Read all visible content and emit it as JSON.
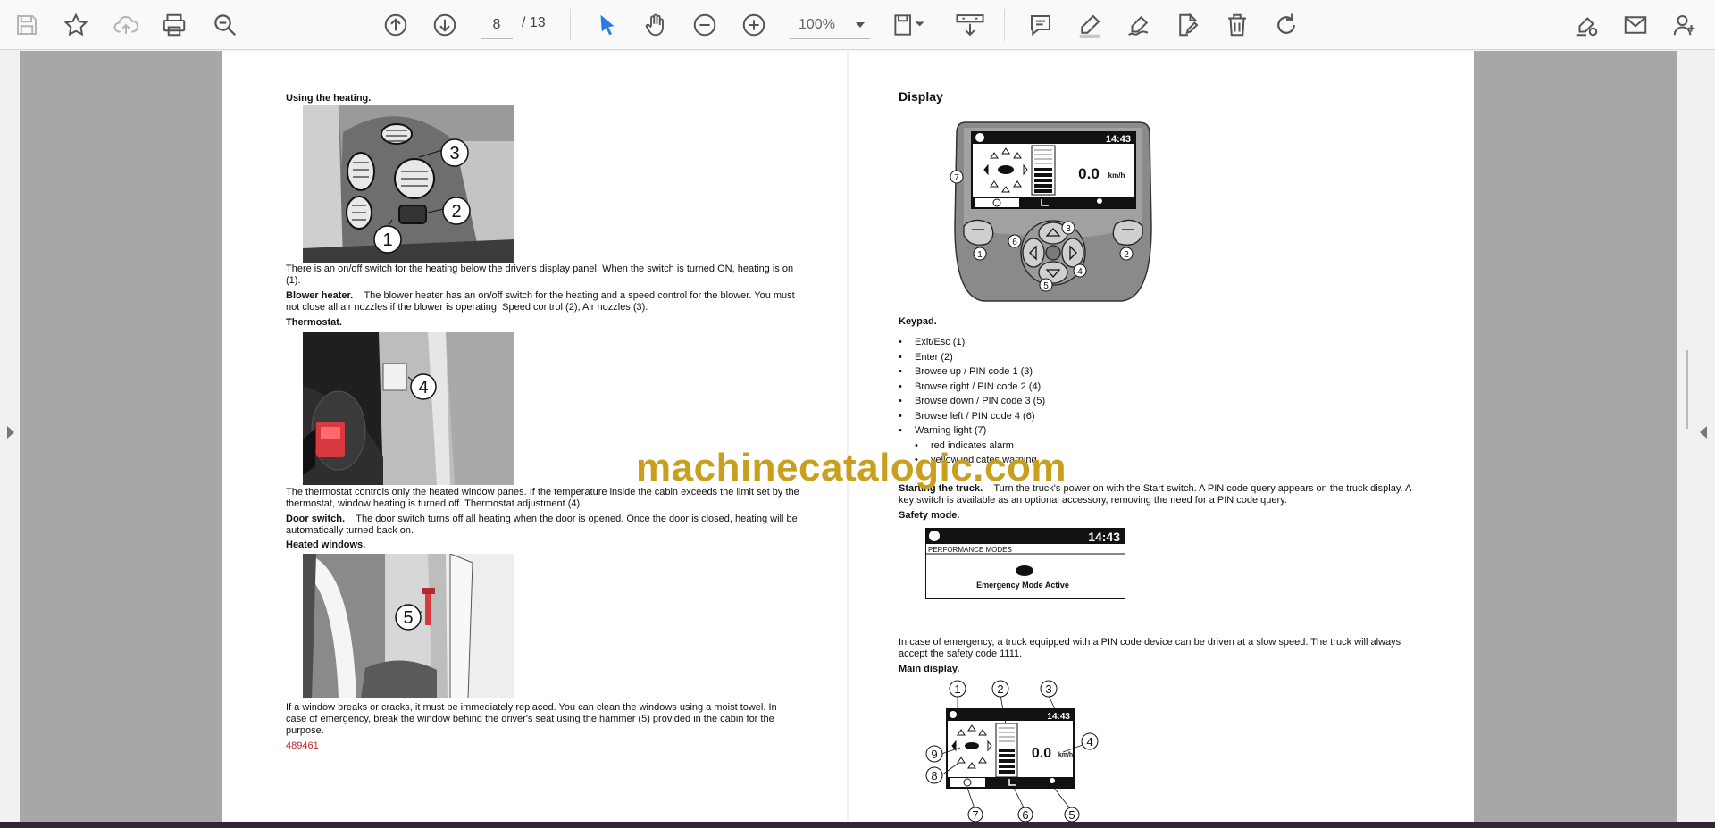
{
  "toolbar": {
    "current_page": "8",
    "total_pages": "/ 13",
    "zoom": "100%"
  },
  "left_page": {
    "heating_heading": "Using the heating.",
    "heating_text": "There is an on/off switch for the heating below the driver's display panel. When the switch is turned ON, heating is on (1).",
    "blower_label": "Blower heater.",
    "blower_text": "The blower heater has an on/off switch for the heating and a speed control for the blower. You must not close all air nozzles if the blower is operating. Speed control (2), Air nozzles (3).",
    "thermostat_heading": "Thermostat.",
    "thermostat_text": "The thermostat controls only the heated window panes. If the temperature inside the cabin exceeds the limit set by the thermostat, window heating is turned off. Thermostat adjustment (4).",
    "door_label": "Door switch.",
    "door_text": "The door switch turns off all heating when the door is opened. Once the door is closed, heating will be automatically turned back on.",
    "windows_heading": "Heated windows.",
    "windows_text": "If a window breaks or cracks, it must be immediately replaced. You can clean the windows using a moist towel. In case of emergency, break the window behind the driver's seat using the hammer (5) provided in the cabin for the purpose.",
    "doc_number": "489461",
    "fig1_callouts": [
      "3",
      "2",
      "1"
    ],
    "fig2_callout": "4",
    "fig3_callout": "5"
  },
  "right_page": {
    "display_heading": "Display",
    "display_time": "14:43",
    "display_speed": "0.0",
    "display_unit": "km/h",
    "keypad_callouts": [
      "7",
      "3",
      "6",
      "1",
      "2",
      "4",
      "5"
    ],
    "keypad_heading": "Keypad.",
    "keypad_items": [
      "Exit/Esc (1)",
      "Enter (2)",
      "Browse up / PIN code 1 (3)",
      "Browse right / PIN code 2 (4)",
      "Browse down / PIN code 3 (5)",
      "Browse left / PIN code 4 (6)",
      "Warning light (7)"
    ],
    "warning_sub_items": [
      "red indicates alarm",
      "yellow indicates warning"
    ],
    "starting_label": "Starting the truck.",
    "starting_text": "Turn the truck's power on with the Start switch. A PIN code query appears on the truck display. A key switch is available as an optional accessory, removing the need for a PIN code query.",
    "safety_heading": "Safety mode.",
    "safety_time": "14:43",
    "safety_modes": "PERFORMANCE MODES",
    "safety_message": "Emergency Mode Active",
    "emergency_text": "In case of emergency, a truck equipped with a PIN code device can be driven at a slow speed. The truck will always accept the safety code 1111.",
    "main_display_heading": "Main display.",
    "main_time": "14:43",
    "main_speed": "0.0",
    "main_unit": "km/h",
    "main_callouts": [
      "1",
      "2",
      "3",
      "4",
      "9",
      "8",
      "7",
      "6",
      "5"
    ]
  },
  "watermark": "machinecatalogic.com",
  "colors": {
    "toolbar_bg": "#f9f9f9",
    "viewer_gray": "#a7a7a7",
    "accent_blue": "#2c7be5",
    "watermark": "#c9a01e",
    "doc_number_red": "#c0262c"
  },
  "icons": [
    "save-icon",
    "bookmark-star-icon",
    "upload-cloud-icon",
    "print-icon",
    "zoom-search-icon",
    "page-up-icon",
    "page-down-icon",
    "select-cursor-icon",
    "hand-pan-icon",
    "zoom-out-icon",
    "zoom-in-icon",
    "page-layout-icon",
    "download-icon",
    "comment-icon",
    "highlight-pen-icon",
    "sign-icon",
    "edit-document-icon",
    "delete-icon",
    "rotate-icon",
    "fill-sign-icon",
    "email-icon",
    "add-user-icon"
  ]
}
